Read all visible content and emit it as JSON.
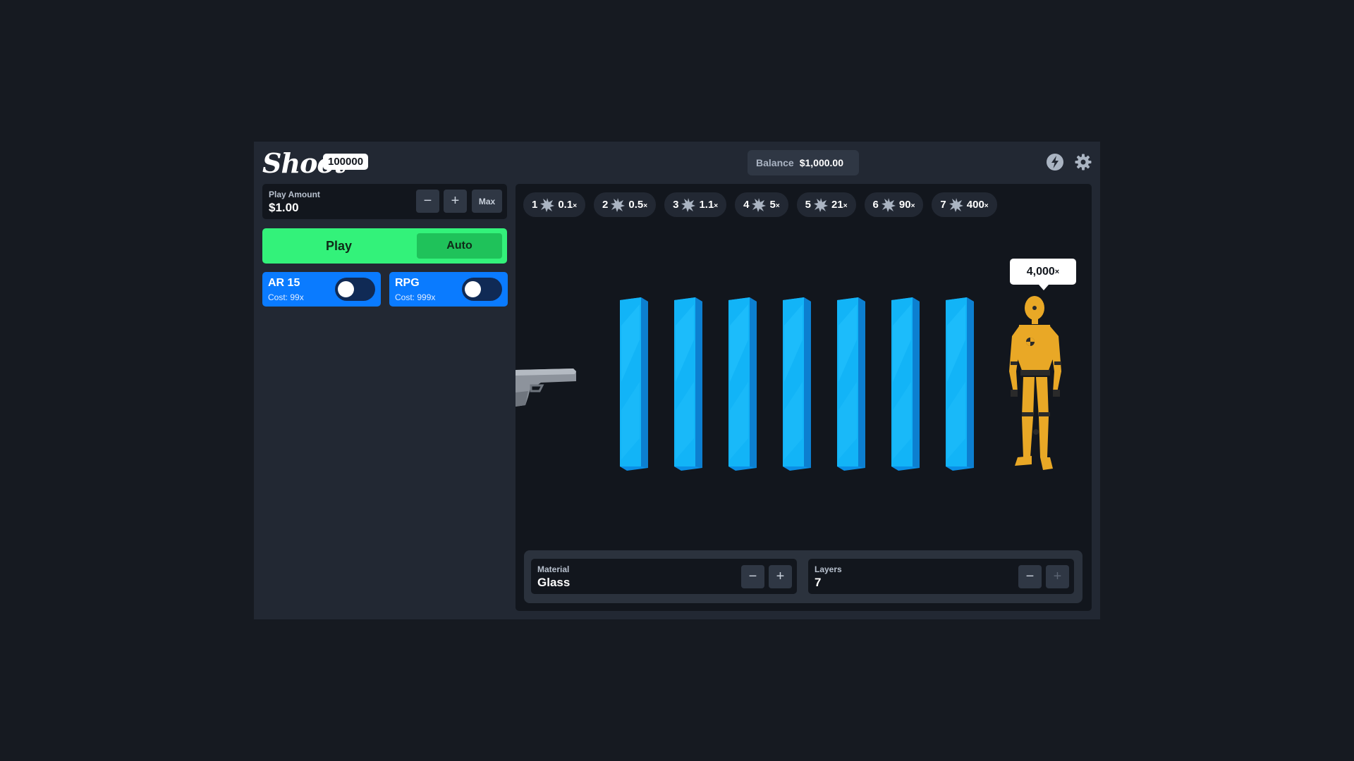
{
  "header": {
    "logo": "Shoot",
    "badge": "100000",
    "balance_label": "Balance",
    "balance_value": "$1,000.00",
    "icons": [
      "lightning-icon",
      "gear-icon"
    ]
  },
  "play_amount": {
    "label": "Play Amount",
    "value": "$1.00",
    "minus": "−",
    "plus": "+",
    "max": "Max"
  },
  "play": {
    "play_label": "Play",
    "auto_label": "Auto"
  },
  "weapons": [
    {
      "name": "AR 15",
      "cost": "Cost: 99x",
      "enabled": false
    },
    {
      "name": "RPG",
      "cost": "Cost: 999x",
      "enabled": false
    }
  ],
  "multipliers": [
    {
      "layer": "1",
      "value": "0.1",
      "suffix": "×"
    },
    {
      "layer": "2",
      "value": "0.5",
      "suffix": "×"
    },
    {
      "layer": "3",
      "value": "1.1",
      "suffix": "×"
    },
    {
      "layer": "4",
      "value": "5",
      "suffix": "×"
    },
    {
      "layer": "5",
      "value": "21",
      "suffix": "×"
    },
    {
      "layer": "6",
      "value": "90",
      "suffix": "×"
    },
    {
      "layer": "7",
      "value": "400",
      "suffix": "×"
    }
  ],
  "target": {
    "value": "4,000",
    "suffix": "×"
  },
  "panes_count": 7,
  "material": {
    "label": "Material",
    "value": "Glass"
  },
  "layers": {
    "label": "Layers",
    "value": "7"
  },
  "colors": {
    "play": "#33f27a",
    "weapon": "#0a7bff",
    "glass": "#12b4f7",
    "dummy": "#e9a826"
  }
}
